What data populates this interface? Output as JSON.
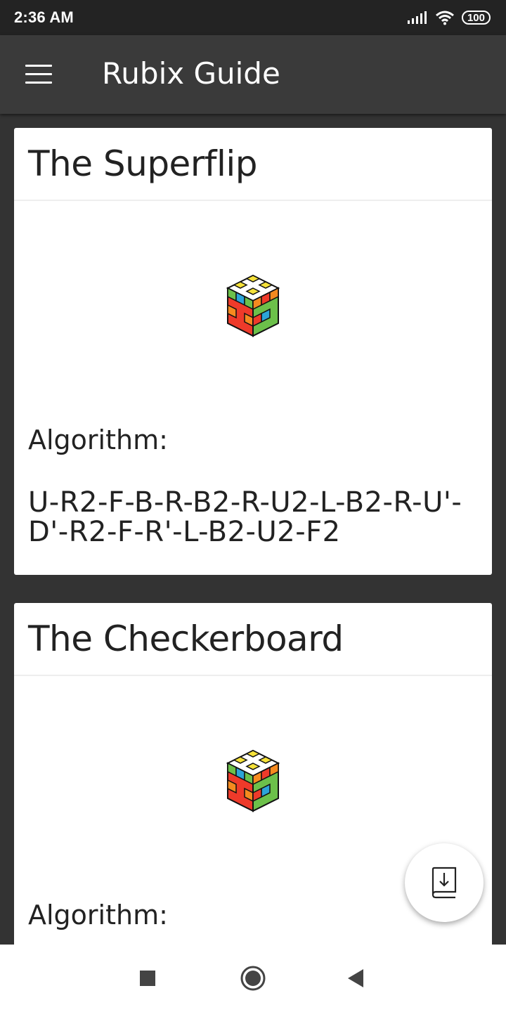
{
  "status_bar": {
    "time": "2:36 AM",
    "battery": "100",
    "icons": [
      "signal-icon",
      "wifi-icon",
      "battery-icon"
    ]
  },
  "app_bar": {
    "title": "Rubix Guide",
    "menu_icon": "menu-icon"
  },
  "cards": [
    {
      "title": "The Superflip",
      "algorithm_label": "Algorithm:",
      "algorithm": "U-R2-F-B-R-B2-R-U2-L-B2-R-U'-D'-R2-F-R'-L-B2-U2-F2"
    },
    {
      "title": "The Checkerboard",
      "algorithm_label": "Algorithm:"
    }
  ],
  "fab": {
    "icon": "book-download-icon"
  },
  "nav_bar": {
    "icons": [
      "recents-icon",
      "home-icon",
      "back-icon"
    ]
  },
  "colors": {
    "background": "#333333",
    "app_bar": "#3a3a3a",
    "status_bar": "#232323",
    "card": "#ffffff",
    "text": "#222222"
  }
}
